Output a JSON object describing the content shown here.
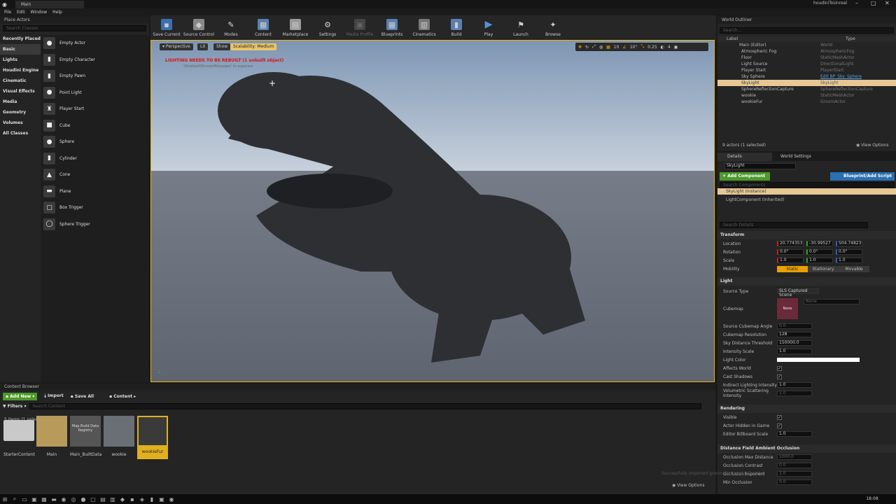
{
  "window": {
    "tab": "Main",
    "project": "houdiniToUnreal"
  },
  "menu": [
    "File",
    "Edit",
    "Window",
    "Help"
  ],
  "place_actors": {
    "title": "Place Actors",
    "search": "Search Classes",
    "categories": [
      "Recently Placed",
      "Basic",
      "Lights",
      "Houdini Engine",
      "Cinematic",
      "Visual Effects",
      "Media",
      "Geometry",
      "Volumes",
      "All Classes"
    ],
    "items": [
      "Empty Actor",
      "Empty Character",
      "Empty Pawn",
      "Point Light",
      "Player Start",
      "Cube",
      "Sphere",
      "Cylinder",
      "Cone",
      "Plane",
      "Box Trigger",
      "Sphere Trigger"
    ]
  },
  "toolbar": [
    "Save Current",
    "Source Control",
    "Modes",
    "Content",
    "Marketplace",
    "Settings",
    "Media Profile",
    "Blueprints",
    "Cinematics",
    "Build",
    "Play",
    "Launch",
    "Browse"
  ],
  "viewport": {
    "perspective": "Perspective",
    "lit": "Lit",
    "show": "Show",
    "scalability": "Scalability: Medium",
    "warning": "LIGHTING NEEDS TO BE REBUILT (1 unbuilt object)",
    "warning2": "'DisableAllScreenMessages' to suppress",
    "snap": [
      "10",
      "10°",
      "0.25",
      "4"
    ]
  },
  "outliner": {
    "title": "World Outliner",
    "search": "Search...",
    "col_label": "Label",
    "col_type": "Type",
    "rows": [
      [
        "Main (Editor)",
        "World"
      ],
      [
        "Atmospheric Fog",
        "AtmosphericFog"
      ],
      [
        "Floor",
        "StaticMeshActor"
      ],
      [
        "Light Source",
        "DirectionalLight"
      ],
      [
        "Player Start",
        "PlayerStart"
      ],
      [
        "Sky Sphere",
        "Edit BP_Sky_Sphere"
      ],
      [
        "SkyLight",
        "SkyLight"
      ],
      [
        "SphereReflectionCapture",
        "SphereReflectionCapture"
      ],
      [
        "wookie",
        "StaticMeshActor"
      ],
      [
        "wookieFur",
        "GroomActor"
      ]
    ],
    "status": "9 actors (1 selected)",
    "view_options": "View Options"
  },
  "details": {
    "tab1": "Details",
    "tab2": "World Settings",
    "name": "SkyLight",
    "add_component": "+ Add Component",
    "blueprint": "Blueprint/Add Script",
    "search_components": "Search Components",
    "instance": "SkyLight (Instance)",
    "component": "LightComponent (Inherited)",
    "search_details": "Search Details",
    "transform": "Transform",
    "location_label": "Location",
    "rotation_label": "Rotation",
    "scale_label": "Scale",
    "mobility_label": "Mobility",
    "location": [
      "20.774353",
      "-30.99527",
      "504.74823"
    ],
    "rotation": [
      "0.0°",
      "0.0°",
      "0.0°"
    ],
    "scale": [
      "1.0",
      "1.0",
      "1.0"
    ],
    "mobility": [
      "Static",
      "Stationary",
      "Movable"
    ],
    "light": "Light",
    "source_type_label": "Source Type",
    "source_type": "SLS Captured Scene",
    "cubemap_label": "Cubemap",
    "cubemap_none": "None",
    "cubemap_select": "None",
    "props": [
      [
        "Source Cubemap Angle",
        "0.0"
      ],
      [
        "Cubemap Resolution",
        "128"
      ],
      [
        "Sky Distance Threshold",
        "150000.0"
      ],
      [
        "Intensity Scale",
        "1.0"
      ]
    ],
    "light_color": "Light Color",
    "checks": [
      "Affects World",
      "Cast Shadows"
    ],
    "props2": [
      [
        "Indirect Lighting Intensity",
        "1.0"
      ],
      [
        "Volumetric Scattering Intensity",
        "1.0"
      ]
    ],
    "rendering": "Rendering",
    "visible": "Visible",
    "hidden": "Actor Hidden in Game",
    "billboard_label": "Editor Billboard Scale",
    "billboard": "1.0",
    "dfao": "Distance Field Ambient Occlusion",
    "dfao_props": [
      [
        "Occlusion Max Distance",
        "1000.0"
      ],
      [
        "Occlusion Contrast",
        "0.0"
      ],
      [
        "Occlusion Exponent",
        "1.0"
      ],
      [
        "Min Occlusion",
        "0.0"
      ]
    ]
  },
  "content_browser": {
    "title": "Content Browser",
    "add_new": "Add New",
    "import": "Import",
    "save_all": "Save All",
    "path": "Content",
    "filters": "Filters",
    "search": "Search Content",
    "assets": [
      "StarterContent",
      "Main",
      "Main_BuiltData",
      "wookie",
      "wookieFur"
    ],
    "registry": "Map Build Data Registry",
    "status": "5 items (1 selected)",
    "view_options": "View Options",
    "toast": "Successfully imported groom file (wookieFur.abc)"
  },
  "clock": "18:08",
  "colors": {
    "accent": "#e7c894",
    "selected": "#f0b400",
    "green": "#4c9a2a",
    "blue": "#2a6fb0"
  }
}
